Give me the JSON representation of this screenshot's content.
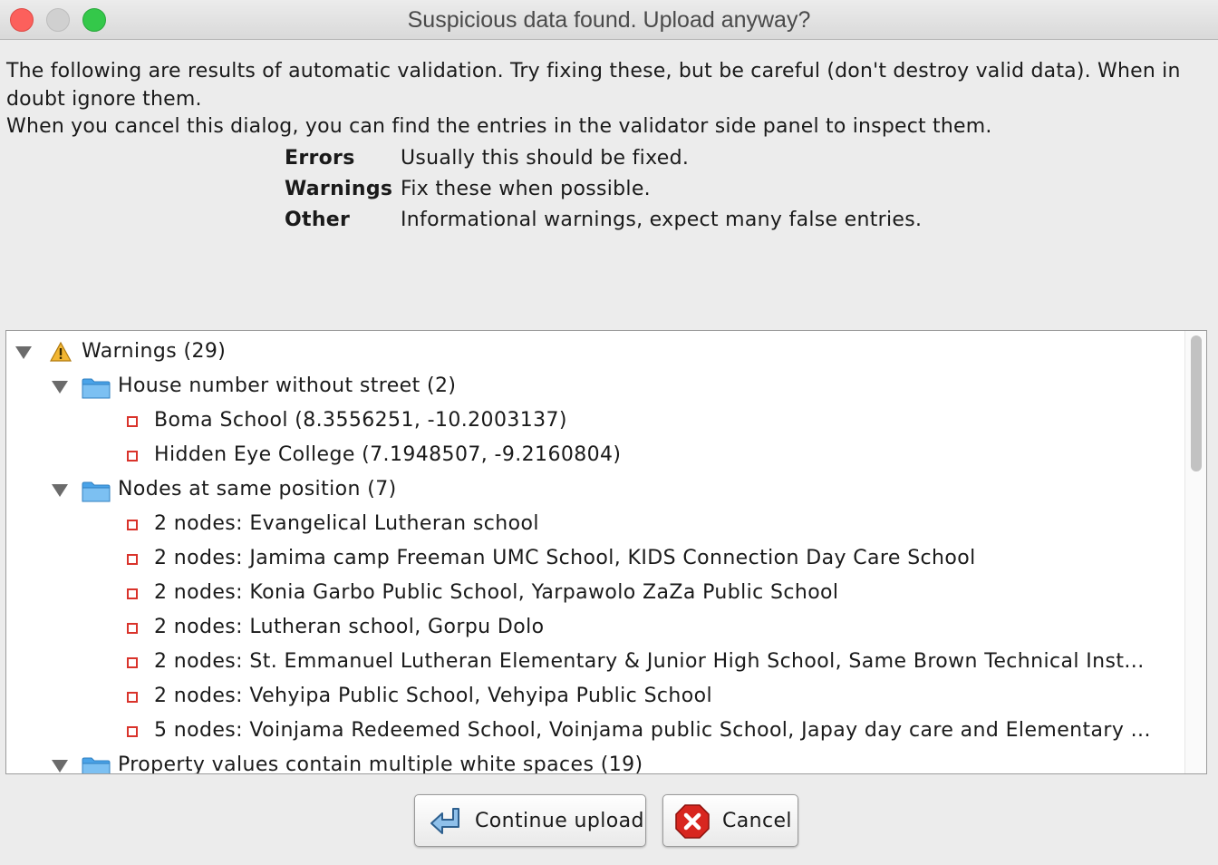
{
  "window": {
    "title": "Suspicious data found. Upload anyway?",
    "traffic_lights": [
      "close",
      "minimize",
      "maximize"
    ]
  },
  "intro": {
    "line1": "The following are results of automatic validation. Try fixing these, but be careful (don't destroy valid data). When in doubt ignore them.",
    "line2": "When you cancel this dialog, you can find the entries in the validator side panel to inspect them."
  },
  "legend": [
    {
      "term": "Errors",
      "desc": "Usually this should be fixed."
    },
    {
      "term": "Warnings",
      "desc": "Fix these when possible."
    },
    {
      "term": "Other",
      "desc": "Informational warnings, expect many false entries."
    }
  ],
  "tree": {
    "root": {
      "label": "Warnings (29)",
      "icon": "warning-icon",
      "expanded": true
    },
    "groups": [
      {
        "label": "House number without street (2)",
        "icon": "folder-icon",
        "expanded": true,
        "items": [
          "Boma School (8.3556251, -10.2003137)",
          "Hidden Eye College (7.1948507, -9.2160804)"
        ]
      },
      {
        "label": "Nodes at same position (7)",
        "icon": "folder-icon",
        "expanded": true,
        "items": [
          "2 nodes: Evangelical Lutheran school",
          "2 nodes: Jamima camp Freeman UMC School, KIDS Connection Day Care School",
          "2 nodes: Konia Garbo Public School, Yarpawolo ZaZa Public School",
          "2 nodes: Lutheran school, Gorpu Dolo",
          "2 nodes: St. Emmanuel Lutheran Elementary & Junior High School, Same Brown Technical Inst...",
          "2 nodes: Vehyipa Public School, Vehyipa Public School",
          "5 nodes: Voinjama Redeemed School, Voinjama public School, Japay day care and Elementary ..."
        ]
      },
      {
        "label": "Property values contain multiple white spaces (19)",
        "icon": "folder-icon",
        "expanded": true,
        "items": []
      }
    ]
  },
  "buttons": {
    "continue": {
      "label": "Continue upload",
      "icon": "upload-arrow-icon"
    },
    "cancel": {
      "label": "Cancel",
      "icon": "cancel-x-icon"
    }
  },
  "colors": {
    "item_marker": "#d9332b",
    "folder": "#4aa3e8",
    "close_light": "#fc605c",
    "max_light": "#34c84a"
  }
}
